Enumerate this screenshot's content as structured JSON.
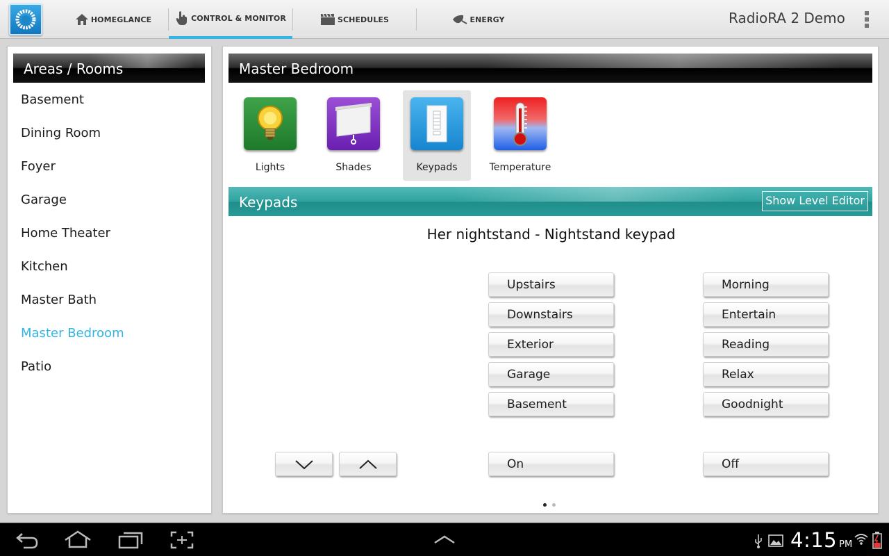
{
  "app": {
    "title": "RadioRA 2 Demo"
  },
  "tabs": [
    {
      "label": "HOMEGLANCE",
      "icon": "house-icon"
    },
    {
      "label": "CONTROL & MONITOR",
      "icon": "hand-pointer-icon",
      "active": true
    },
    {
      "label": "SCHEDULES",
      "icon": "clapboard-icon"
    },
    {
      "label": "ENERGY",
      "icon": "leaf-plug-icon"
    }
  ],
  "areas": {
    "title": "Areas / Rooms",
    "rooms": [
      "Basement",
      "Dining Room",
      "Foyer",
      "Garage",
      "Home Theater",
      "Kitchen",
      "Master Bath",
      "Master Bedroom",
      "Patio"
    ],
    "selected": "Master Bedroom"
  },
  "room": {
    "title": "Master Bedroom",
    "categories": [
      {
        "label": "Lights",
        "icon": "lightbulb-icon"
      },
      {
        "label": "Shades",
        "icon": "shade-icon"
      },
      {
        "label": "Keypads",
        "icon": "keypad-icon",
        "selected": true
      },
      {
        "label": "Temperature",
        "icon": "thermometer-icon"
      }
    ]
  },
  "keypads": {
    "header": "Keypads",
    "level_editor_label": "Show Level Editor",
    "keypad_title": "Her nightstand - Nightstand keypad",
    "left_buttons": [
      "Upstairs",
      "Downstairs",
      "Exterior",
      "Garage",
      "Basement"
    ],
    "right_buttons": [
      "Morning",
      "Entertain",
      "Reading",
      "Relax",
      "Goodnight"
    ],
    "on_label": "On",
    "off_label": "Off",
    "page_count": 2,
    "current_page": 1
  },
  "status": {
    "time": "4:15",
    "ampm": "PM"
  },
  "colors": {
    "accent": "#33b5e5",
    "keypad_header": "#2ea29f"
  }
}
